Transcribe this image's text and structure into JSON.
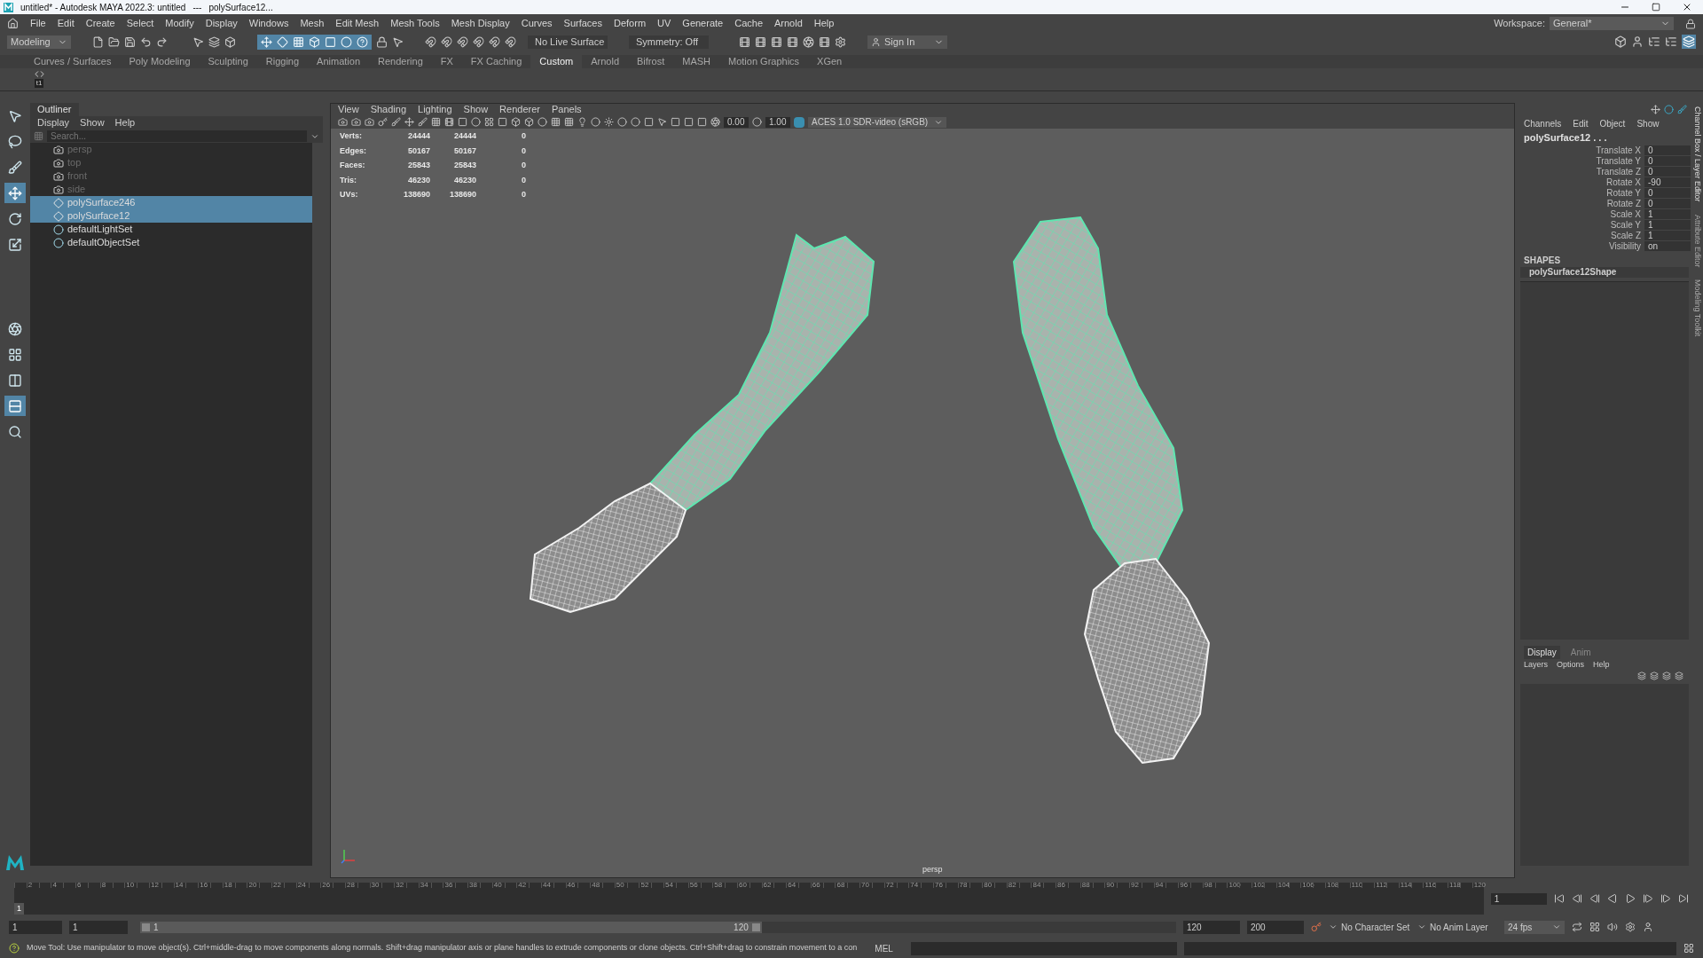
{
  "window": {
    "title": [
      "untitled* - Autodesk MAYA 2022.3: untitled",
      "---",
      "polySurface12..."
    ]
  },
  "menu": [
    "File",
    "Edit",
    "Create",
    "Select",
    "Modify",
    "Display",
    "Windows",
    "Mesh",
    "Edit Mesh",
    "Mesh Tools",
    "Mesh Display",
    "Curves",
    "Surfaces",
    "Deform",
    "UV",
    "Generate",
    "Cache",
    "Arnold",
    "Help"
  ],
  "workspace": {
    "label": "Workspace:",
    "value": "General*"
  },
  "status_toolbar": {
    "mode": "Modeling",
    "live_surface": "No Live Surface",
    "symmetry": "Symmetry: Off",
    "sign_in": "Sign In"
  },
  "shelf_tabs": [
    {
      "label": "Curves / Surfaces",
      "selected": false
    },
    {
      "label": "Poly Modeling",
      "selected": false
    },
    {
      "label": "Sculpting",
      "selected": false
    },
    {
      "label": "Rigging",
      "selected": false
    },
    {
      "label": "Animation",
      "selected": false
    },
    {
      "label": "Rendering",
      "selected": false
    },
    {
      "label": "FX",
      "selected": false
    },
    {
      "label": "FX Caching",
      "selected": false
    },
    {
      "label": "Custom",
      "selected": true
    },
    {
      "label": "Arnold",
      "selected": false
    },
    {
      "label": "Bifrost",
      "selected": false
    },
    {
      "label": "MASH",
      "selected": false
    },
    {
      "label": "Motion Graphics",
      "selected": false
    },
    {
      "label": "XGen",
      "selected": false
    }
  ],
  "shelf": {
    "items": [
      "t1"
    ]
  },
  "toolbox": [
    {
      "selected": false
    },
    {
      "selected": false
    },
    {
      "selected": false
    },
    {
      "selected": true
    },
    {
      "selected": false
    },
    {
      "selected": false
    },
    {
      "selected": false
    },
    {
      "selected": false
    },
    {
      "selected": false
    },
    {
      "selected": true
    },
    {
      "selected": false
    }
  ],
  "outliner": {
    "title": "Outliner",
    "menu": [
      "Display",
      "Show",
      "Help"
    ],
    "search": {
      "placeholder": "Search..."
    },
    "items": [
      {
        "name": "persp",
        "kind": "camera",
        "hidden": true,
        "selected": false
      },
      {
        "name": "top",
        "kind": "camera",
        "hidden": true,
        "selected": false
      },
      {
        "name": "front",
        "kind": "camera",
        "hidden": true,
        "selected": false
      },
      {
        "name": "side",
        "kind": "camera",
        "hidden": true,
        "selected": false
      },
      {
        "name": "polySurface246",
        "kind": "mesh",
        "hidden": false,
        "selected": true
      },
      {
        "name": "polySurface12",
        "kind": "mesh",
        "hidden": false,
        "selected": true
      },
      {
        "name": "defaultLightSet",
        "kind": "set",
        "hidden": false,
        "selected": false
      },
      {
        "name": "defaultObjectSet",
        "kind": "set",
        "hidden": false,
        "selected": false
      }
    ]
  },
  "viewport": {
    "menu": [
      "View",
      "Shading",
      "Lighting",
      "Show",
      "Renderer",
      "Panels"
    ],
    "exposure": "0.00",
    "gamma": "1.00",
    "color_space": "ACES 1.0 SDR-video (sRGB)",
    "hud": [
      {
        "label": "Verts:",
        "values": [
          "24444",
          "24444",
          "0"
        ]
      },
      {
        "label": "Edges:",
        "values": [
          "50167",
          "50167",
          "0"
        ]
      },
      {
        "label": "Faces:",
        "values": [
          "25843",
          "25843",
          "0"
        ]
      },
      {
        "label": "Tris:",
        "values": [
          "46230",
          "46230",
          "0"
        ]
      },
      {
        "label": "UVs:",
        "values": [
          "138690",
          "138690",
          "0"
        ]
      }
    ],
    "camera": "persp"
  },
  "channel_box": {
    "menu": [
      "Channels",
      "Edit",
      "Object",
      "Show"
    ],
    "object": "polySurface12 . . .",
    "channels": [
      {
        "name": "Translate X",
        "value": "0"
      },
      {
        "name": "Translate Y",
        "value": "0"
      },
      {
        "name": "Translate Z",
        "value": "0"
      },
      {
        "name": "Rotate X",
        "value": "-90"
      },
      {
        "name": "Rotate Y",
        "value": "0"
      },
      {
        "name": "Rotate Z",
        "value": "0"
      },
      {
        "name": "Scale X",
        "value": "1"
      },
      {
        "name": "Scale Y",
        "value": "1"
      },
      {
        "name": "Scale Z",
        "value": "1"
      },
      {
        "name": "Visibility",
        "value": "on"
      }
    ],
    "shapes_heading": "SHAPES",
    "shape": "polySurface12Shape"
  },
  "side_tabs": [
    "Channel Box / Layer Editor",
    "Attribute Editor",
    "Modeling Toolkit"
  ],
  "layer_editor": {
    "tabs": [
      {
        "label": "Display",
        "selected": true
      },
      {
        "label": "Anim",
        "selected": false
      }
    ],
    "menu": [
      "Layers",
      "Options",
      "Help"
    ]
  },
  "timeline": {
    "ticks": [
      "2",
      "4",
      "6",
      "8",
      "10",
      "12",
      "14",
      "16",
      "18",
      "20",
      "22",
      "24",
      "26",
      "28",
      "30",
      "32",
      "34",
      "36",
      "38",
      "40",
      "42",
      "44",
      "46",
      "48",
      "50",
      "52",
      "54",
      "56",
      "58",
      "60",
      "62",
      "64",
      "66",
      "68",
      "70",
      "72",
      "74",
      "76",
      "78",
      "80",
      "82",
      "84",
      "86",
      "88",
      "90",
      "92",
      "94",
      "96",
      "98",
      "100",
      "102",
      "104",
      "106",
      "108",
      "110",
      "112",
      "114",
      "116",
      "118",
      "120"
    ],
    "current": "1",
    "frame_field": "1",
    "level": 0
  },
  "range": {
    "start": "1",
    "playback_start": "1",
    "slider_start": "1",
    "slider_end": "120",
    "level": 0.6,
    "playback_end": "120",
    "end": "200",
    "character_set": "No Character Set",
    "anim_layer": "No Anim Layer",
    "fps": "24 fps"
  },
  "help_line": {
    "text": "Move Tool: Use manipulator to move object(s). Ctrl+middle-drag to move components along normals. Shift+drag manipulator axis or plane handles to extrude components or clone objects. Ctrl+Shift+drag to constrain movement to a con",
    "mel": "MEL"
  }
}
